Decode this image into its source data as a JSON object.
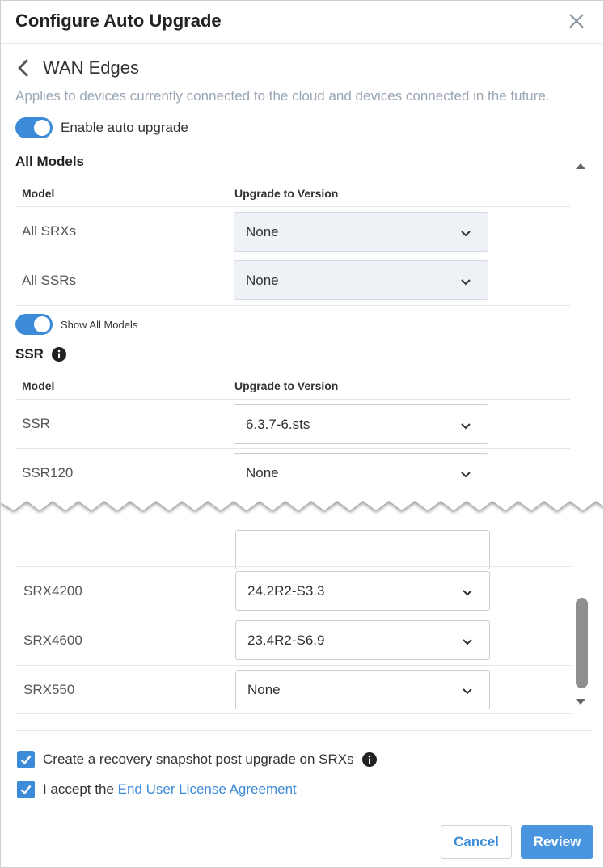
{
  "dialog": {
    "title": "Configure Auto Upgrade",
    "back_title": "WAN Edges",
    "applies_text": "Applies to devices currently connected to the cloud and devices connected in the future.",
    "enable_label": "Enable auto upgrade",
    "enable_on": true
  },
  "all_models": {
    "heading": "All Models",
    "col_model": "Model",
    "col_version": "Upgrade to Version",
    "rows": [
      {
        "model": "All SRXs",
        "version": "None"
      },
      {
        "model": "All SSRs",
        "version": "None"
      }
    ]
  },
  "show_all": {
    "label": "Show All Models",
    "on": true
  },
  "ssr": {
    "heading": "SSR",
    "col_model": "Model",
    "col_version": "Upgrade to Version",
    "rows": [
      {
        "model": "SSR",
        "version": "6.3.7-6.sts"
      },
      {
        "model": "SSR120",
        "version": "None"
      }
    ]
  },
  "srx_lower": {
    "rows": [
      {
        "model": "SRX4200",
        "version": "24.2R2-S3.3"
      },
      {
        "model": "SRX4600",
        "version": "23.4R2-S6.9"
      },
      {
        "model": "SRX550",
        "version": "None"
      }
    ]
  },
  "options": {
    "snapshot_label": "Create a recovery snapshot post upgrade on SRXs",
    "eula_prefix": "I accept the ",
    "eula_link": "End User License Agreement"
  },
  "buttons": {
    "cancel": "Cancel",
    "review": "Review"
  },
  "colors": {
    "accent": "#3c8bd9",
    "muted": "#9aa6b2"
  }
}
